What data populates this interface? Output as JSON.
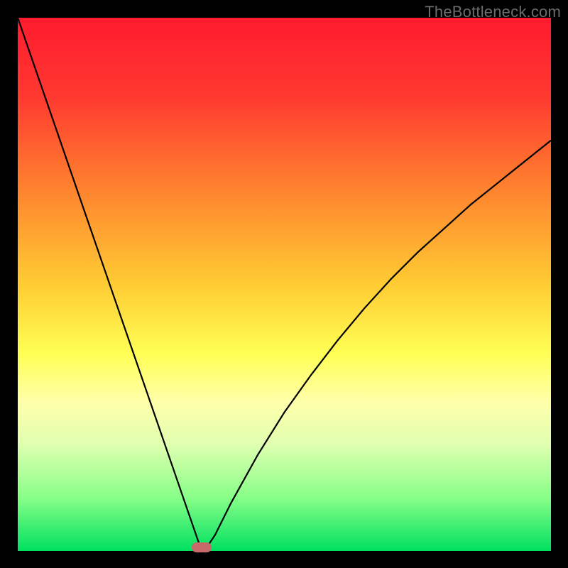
{
  "watermark": "TheBottleneck.com",
  "chart_data": {
    "type": "line",
    "title": "",
    "xlabel": "",
    "ylabel": "",
    "xlim": [
      0,
      100
    ],
    "ylim": [
      0,
      100
    ],
    "series": [
      {
        "name": "curve",
        "x": [
          0,
          5,
          10,
          15,
          20,
          25,
          30,
          33,
          34,
          35,
          37,
          40,
          45,
          50,
          55,
          60,
          65,
          70,
          75,
          80,
          85,
          90,
          95,
          100
        ],
        "values": [
          100,
          85.5,
          71,
          56.5,
          42,
          27.5,
          13,
          4.3,
          1.4,
          0,
          3,
          9,
          18,
          26,
          33,
          39.5,
          45.5,
          51,
          56,
          60.5,
          65,
          69,
          73,
          77
        ]
      }
    ],
    "annotations": [
      {
        "name": "low-point-marker",
        "x": 34.5,
        "y": 0.7
      }
    ],
    "gradient_stops": [
      "#ff1a2e",
      "#ff7a2e",
      "#ffff55",
      "#00e060"
    ]
  }
}
